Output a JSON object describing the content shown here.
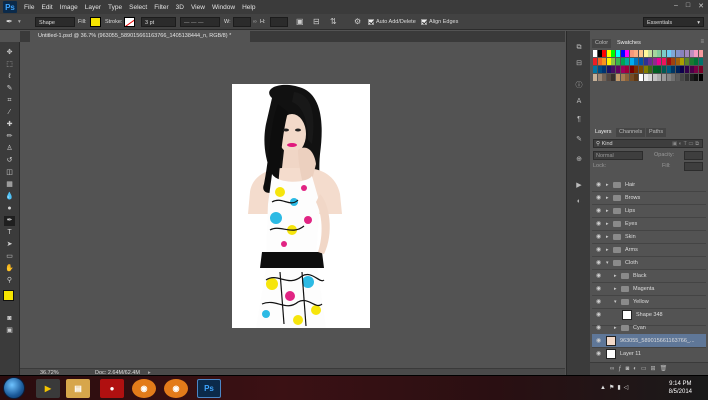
{
  "app": {
    "logo": "Ps"
  },
  "menubar": {
    "items": [
      "File",
      "Edit",
      "Image",
      "Layer",
      "Type",
      "Select",
      "Filter",
      "3D",
      "View",
      "Window",
      "Help"
    ]
  },
  "options": {
    "tool_mode": "Shape",
    "fill_label": "Fill:",
    "fill_color": "#f6e400",
    "stroke_label": "Stroke:",
    "stroke_width": "3 pt",
    "w_label": "W:",
    "h_label": "H:",
    "auto_add_delete": "Auto Add/Delete",
    "align_edges": "Align Edges",
    "workspace": "Essentials"
  },
  "document": {
    "tab_title": "Untitled-1.psd @ 36.7% (963055_589015661163766_1405138444_n, RGB/8) *"
  },
  "status": {
    "zoom": "36.72%",
    "doc": "Doc: 2.64M/62.4M"
  },
  "panels": {
    "color_tab": "Color",
    "swatches_tab": "Swatches",
    "layers_tab": "Layers",
    "channels_tab": "Channels",
    "paths_tab": "Paths",
    "kind_filter": "Kind",
    "blend_mode": "Normal",
    "opacity_label": "Opacity:",
    "lock_label": "Lock:",
    "fill_label": "Fill:"
  },
  "layers": [
    {
      "name": "Hair",
      "type": "group",
      "indent": 0,
      "expanded": false
    },
    {
      "name": "Brows",
      "type": "group",
      "indent": 0,
      "expanded": false
    },
    {
      "name": "Lips",
      "type": "group",
      "indent": 0,
      "expanded": false
    },
    {
      "name": "Eyes",
      "type": "group",
      "indent": 0,
      "expanded": false
    },
    {
      "name": "Skin",
      "type": "group",
      "indent": 0,
      "expanded": false
    },
    {
      "name": "Arms",
      "type": "group",
      "indent": 0,
      "expanded": false
    },
    {
      "name": "Cloth",
      "type": "group",
      "indent": 0,
      "expanded": true
    },
    {
      "name": "Black",
      "type": "group",
      "indent": 1,
      "expanded": false
    },
    {
      "name": "Magenta",
      "type": "group",
      "indent": 1,
      "expanded": false
    },
    {
      "name": "Yellow",
      "type": "group",
      "indent": 1,
      "expanded": true
    },
    {
      "name": "Shape 348",
      "type": "shape",
      "indent": 2
    },
    {
      "name": "Cyan",
      "type": "group",
      "indent": 1,
      "expanded": false
    },
    {
      "name": "963055_589015661163766_...",
      "type": "image",
      "indent": 0,
      "selected": true
    },
    {
      "name": "Layer 11",
      "type": "layer",
      "indent": 0
    }
  ],
  "swatch_colors": [
    "#ffffff",
    "#000000",
    "#ff0000",
    "#ffff00",
    "#00ff00",
    "#00ffff",
    "#0000ff",
    "#ff00ff",
    "#f7977a",
    "#fbad82",
    "#fdc68c",
    "#fff799",
    "#c6df9c",
    "#a4d49d",
    "#81ca9d",
    "#7bcdc8",
    "#6ecff6",
    "#7ea7d8",
    "#8493ca",
    "#8882be",
    "#a187be",
    "#bc8dbf",
    "#f49bc1",
    "#f5999d",
    "#ee1d24",
    "#f16522",
    "#f7941d",
    "#fff200",
    "#8dc63f",
    "#39b54a",
    "#00a651",
    "#00a99d",
    "#00aeef",
    "#0072bc",
    "#0054a6",
    "#2e3192",
    "#662d91",
    "#92278f",
    "#ec008c",
    "#ed145b",
    "#9e0b0f",
    "#a0410d",
    "#a36209",
    "#aba000",
    "#598527",
    "#1a7b30",
    "#007236",
    "#00746b",
    "#0076a3",
    "#004b80",
    "#003471",
    "#1b1464",
    "#440e62",
    "#630460",
    "#9e005d",
    "#9e0039",
    "#790000",
    "#7b2e00",
    "#7d4900",
    "#827b00",
    "#406618",
    "#005e20",
    "#005826",
    "#005952",
    "#005b7f",
    "#003663",
    "#002157",
    "#0d004c",
    "#32004b",
    "#4b0049",
    "#7b0046",
    "#7a0026",
    "#c7b299",
    "#998675",
    "#736357",
    "#534741",
    "#37302d",
    "#c69c6d",
    "#a67c52",
    "#8c6239",
    "#754c24",
    "#603913",
    "#ffffff",
    "#ebebeb",
    "#d7d7d7",
    "#c2c2c2",
    "#adadad",
    "#999999",
    "#858585",
    "#707070",
    "#5c5c5c",
    "#474747",
    "#333333",
    "#1f1f1f",
    "#111111",
    "#000000"
  ],
  "taskbar": {
    "time": "9:14 PM",
    "date": "8/5/2014"
  }
}
